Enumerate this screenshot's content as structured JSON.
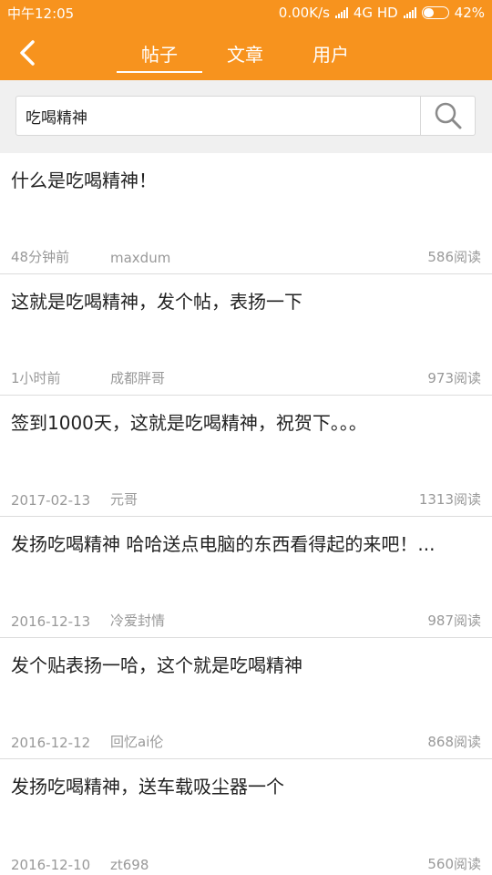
{
  "status_bar": {
    "time": "中午12:05",
    "network": "0.00K/s",
    "net_type": "4G HD",
    "battery": "42%",
    "battery_level": 0.42
  },
  "nav": {
    "tabs": [
      {
        "label": "帖子",
        "active": true
      },
      {
        "label": "文章",
        "active": false
      },
      {
        "label": "用户",
        "active": false
      }
    ]
  },
  "search": {
    "value": "吃喝精神"
  },
  "posts": [
    {
      "title": "什么是吃喝精神！",
      "date": "48分钟前",
      "author": "maxdum",
      "reads": "586阅读"
    },
    {
      "title": "这就是吃喝精神，发个帖，表扬一下",
      "date": "1小时前",
      "author": "成都胖哥",
      "reads": "973阅读"
    },
    {
      "title": "签到1000天，这就是吃喝精神，祝贺下。。。",
      "date": "2017-02-13",
      "author": "元哥",
      "reads": "1313阅读"
    },
    {
      "title": "发扬吃喝精神 哈哈送点电脑的东西看得起的来吧！...",
      "date": "2016-12-13",
      "author": "冷爱封情",
      "reads": "987阅读"
    },
    {
      "title": "发个贴表扬一哈，这个就是吃喝精神",
      "date": "2016-12-12",
      "author": "回忆ai伦",
      "reads": "868阅读"
    },
    {
      "title": "发扬吃喝精神，送车载吸尘器一个",
      "date": "2016-12-10",
      "author": "zt698",
      "reads": "560阅读"
    }
  ],
  "colors": {
    "accent": "#f7931e"
  },
  "icons": [
    "back-arrow-icon",
    "search-icon",
    "signal-icon",
    "battery-icon"
  ]
}
